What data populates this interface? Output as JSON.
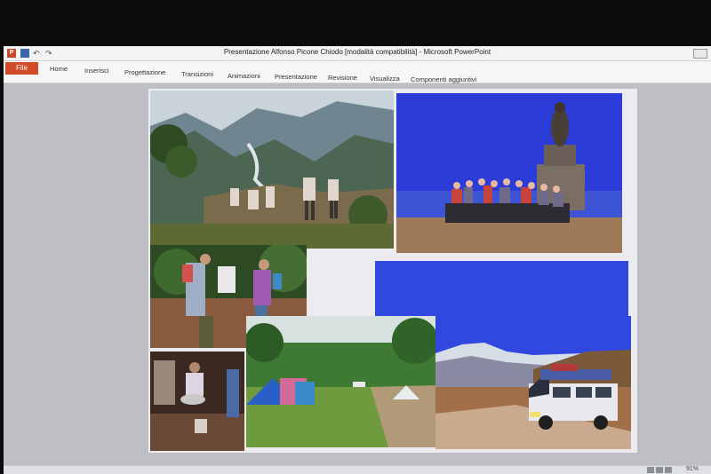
{
  "window": {
    "title": "Presentazione Alfonso Picone Chiodo [modalità compatibilità] - Microsoft PowerPoint"
  },
  "ribbon": {
    "tabs": [
      "File",
      "Home",
      "Inserisci",
      "Progettazione",
      "Transizioni",
      "Animazioni",
      "Presentazione",
      "Revisione",
      "Visualizza",
      "Componenti aggiuntivi"
    ]
  },
  "icons": {
    "app": "powerpoint-icon",
    "save": "save-icon",
    "undo": "undo-icon",
    "redo": "redo-icon"
  },
  "slide": {
    "photos": [
      "mountain-valley-hikers",
      "statue-group-portrait",
      "hikers-with-backpacks",
      "blue-sky-panorama",
      "campsite-meadow-tents",
      "camp-cooking",
      "loaded-van-mountain-road"
    ]
  },
  "status": {
    "zoom": "91%"
  },
  "colors": {
    "file_tab": "#d24b29",
    "sky": "#2a3ad8"
  }
}
